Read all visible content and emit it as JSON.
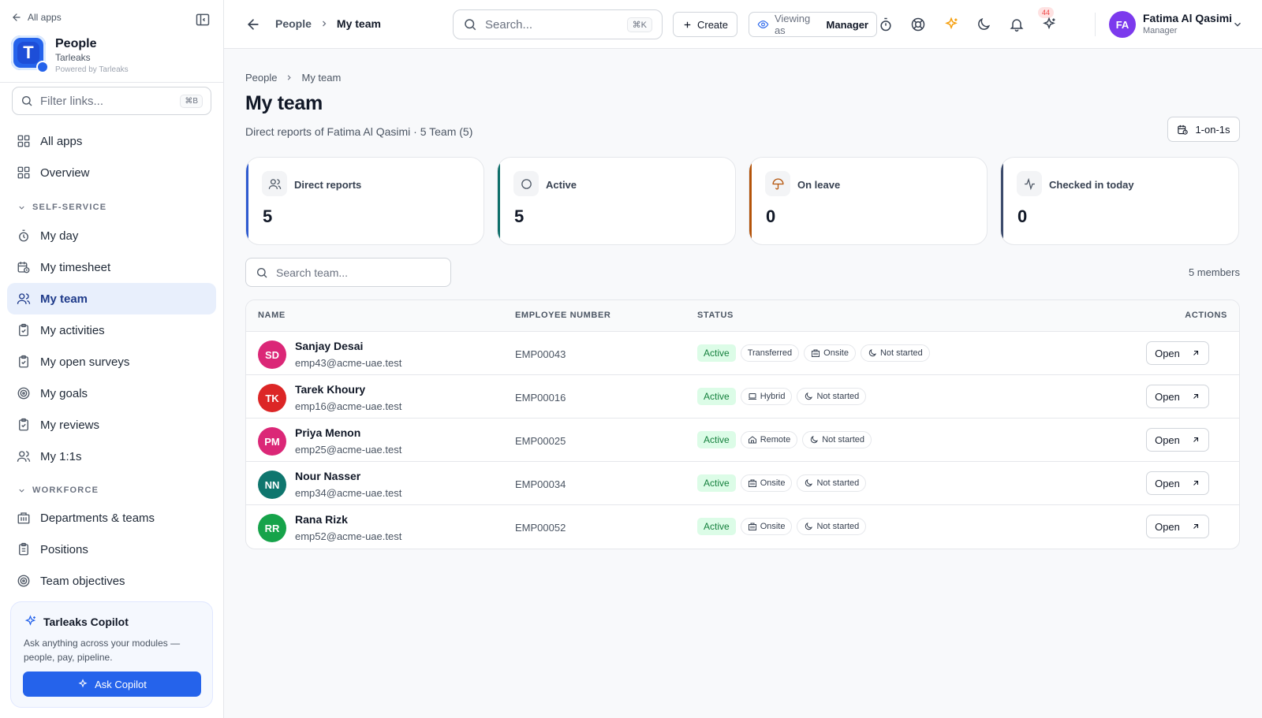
{
  "sidebar": {
    "all_apps_link": "All apps",
    "brand_initial": "T",
    "brand_name": "People",
    "brand_org": "Tarleaks",
    "brand_powered": "Powered by Tarleaks",
    "filter_placeholder": "Filter links...",
    "filter_shortcut": "⌘B",
    "top_items": [
      {
        "label": "All apps",
        "icon": "grid-icon"
      },
      {
        "label": "Overview",
        "icon": "grid-icon"
      }
    ],
    "self_service_label": "SELF-SERVICE",
    "self_service_items": [
      {
        "label": "My day",
        "icon": "stopwatch-icon"
      },
      {
        "label": "My timesheet",
        "icon": "calendar-clock-icon"
      },
      {
        "label": "My team",
        "icon": "users-icon",
        "active": true
      },
      {
        "label": "My activities",
        "icon": "clipboard-check-icon"
      },
      {
        "label": "My open surveys",
        "icon": "clipboard-check-icon"
      },
      {
        "label": "My goals",
        "icon": "target-icon"
      },
      {
        "label": "My reviews",
        "icon": "clipboard-check-icon"
      },
      {
        "label": "My 1:1s",
        "icon": "users-icon"
      }
    ],
    "workforce_label": "WORKFORCE",
    "workforce_items": [
      {
        "label": "Departments & teams",
        "icon": "building-icon"
      },
      {
        "label": "Positions",
        "icon": "clipboard-list-icon"
      },
      {
        "label": "Team objectives",
        "icon": "target-icon"
      }
    ],
    "copilot": {
      "title": "Tarleaks Copilot",
      "description": "Ask anything across your modules — people, pay, pipeline.",
      "button": "Ask Copilot"
    }
  },
  "topbar": {
    "breadcrumb_parent": "People",
    "breadcrumb_current": "My team",
    "search_placeholder": "Search...",
    "search_shortcut": "⌘K",
    "create_label": "Create",
    "viewing_prefix": "Viewing as",
    "viewing_role": "Manager",
    "notification_count": "44",
    "user_initials": "FA",
    "user_name": "Fatima Al Qasimi",
    "user_role": "Manager"
  },
  "main": {
    "breadcrumb_parent": "People",
    "breadcrumb_current": "My team",
    "title": "My team",
    "subtitle": "Direct reports of Fatima Al Qasimi · 5 Team (5)",
    "one_on_ones_button": "1-on-1s",
    "stats": [
      {
        "label": "Direct reports",
        "value": "5",
        "icon": "users-icon",
        "accent": "#2f5bd0"
      },
      {
        "label": "Active",
        "value": "5",
        "icon": "circle-icon",
        "accent": "#0f6f6a"
      },
      {
        "label": "On leave",
        "value": "0",
        "icon": "umbrella-icon",
        "accent": "#b45309"
      },
      {
        "label": "Checked in today",
        "value": "0",
        "icon": "activity-icon",
        "accent": "#3b4a6b"
      }
    ],
    "team_search_placeholder": "Search team...",
    "member_count": "5 members",
    "table": {
      "headers": {
        "name": "NAME",
        "employee_number": "EMPLOYEE NUMBER",
        "status": "STATUS",
        "actions": "ACTIONS"
      },
      "rows": [
        {
          "initials": "SD",
          "avatar_color": "#db2777",
          "name": "Sanjay Desai",
          "email": "emp43@acme-uae.test",
          "number": "EMP00043",
          "status": "Active",
          "chips": [
            {
              "label": "Transferred",
              "icon": ""
            },
            {
              "label": "Onsite",
              "icon": "building-icon"
            },
            {
              "label": "Not started",
              "icon": "moon-icon"
            }
          ],
          "action": "Open"
        },
        {
          "initials": "TK",
          "avatar_color": "#dc2626",
          "name": "Tarek Khoury",
          "email": "emp16@acme-uae.test",
          "number": "EMP00016",
          "status": "Active",
          "chips": [
            {
              "label": "Hybrid",
              "icon": "laptop-icon"
            },
            {
              "label": "Not started",
              "icon": "moon-icon"
            }
          ],
          "action": "Open"
        },
        {
          "initials": "PM",
          "avatar_color": "#db2777",
          "name": "Priya Menon",
          "email": "emp25@acme-uae.test",
          "number": "EMP00025",
          "status": "Active",
          "chips": [
            {
              "label": "Remote",
              "icon": "home-icon"
            },
            {
              "label": "Not started",
              "icon": "moon-icon"
            }
          ],
          "action": "Open"
        },
        {
          "initials": "NN",
          "avatar_color": "#0f766e",
          "name": "Nour Nasser",
          "email": "emp34@acme-uae.test",
          "number": "EMP00034",
          "status": "Active",
          "chips": [
            {
              "label": "Onsite",
              "icon": "building-icon"
            },
            {
              "label": "Not started",
              "icon": "moon-icon"
            }
          ],
          "action": "Open"
        },
        {
          "initials": "RR",
          "avatar_color": "#16a34a",
          "name": "Rana Rizk",
          "email": "emp52@acme-uae.test",
          "number": "EMP00052",
          "status": "Active",
          "chips": [
            {
              "label": "Onsite",
              "icon": "building-icon"
            },
            {
              "label": "Not started",
              "icon": "moon-icon"
            }
          ],
          "action": "Open"
        }
      ]
    }
  }
}
